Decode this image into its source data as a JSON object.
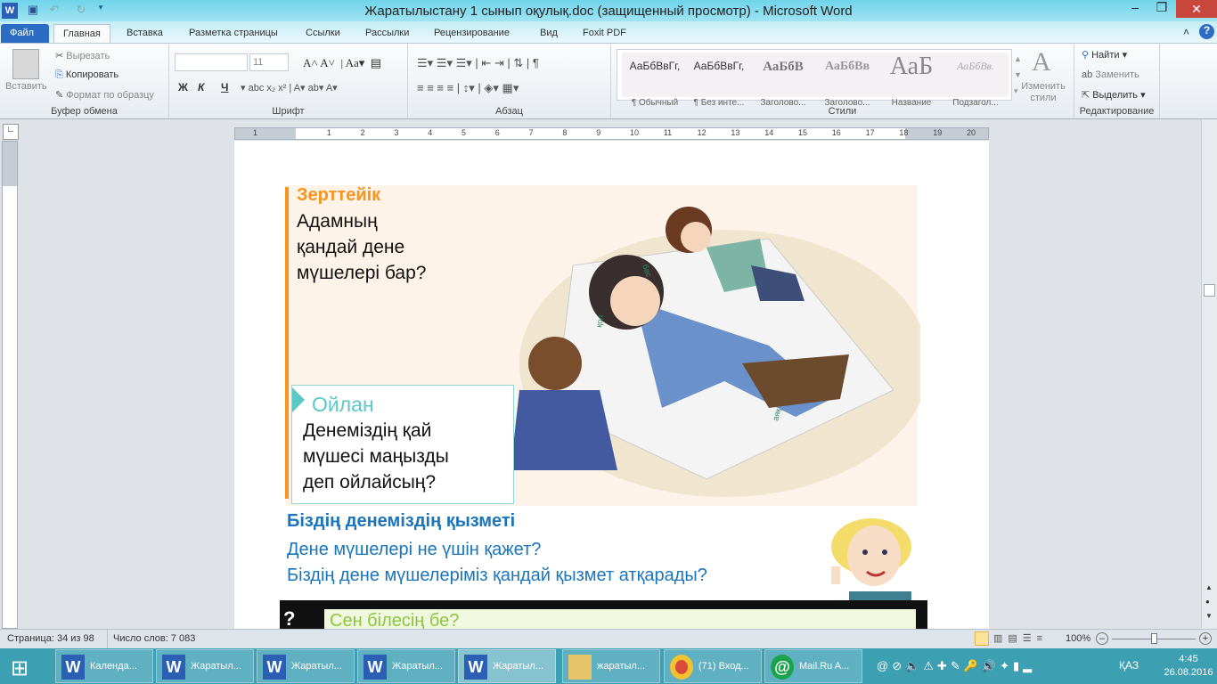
{
  "window": {
    "title": "Жаратылыстану 1 сынып оқулық.doc (защищенный просмотр)  -  Microsoft Word"
  },
  "tabs": [
    "Файл",
    "Главная",
    "Вставка",
    "Разметка страницы",
    "Ссылки",
    "Рассылки",
    "Рецензирование",
    "Вид",
    "Foxit PDF"
  ],
  "clipboard": {
    "paste": "Вставить",
    "cut": "Вырезать",
    "copy": "Копировать",
    "format": "Формат по образцу",
    "label": "Буфер обмена"
  },
  "font": {
    "name": "",
    "size": "11",
    "label": "Шрифт",
    "bold": "Ж",
    "italic": "К",
    "underline": "Ч"
  },
  "paragraph": {
    "label": "Абзац"
  },
  "styles": {
    "label": "Стили",
    "change": "Изменить стили",
    "items": [
      {
        "sample": "АаБбВвГг,",
        "name": "¶ Обычный"
      },
      {
        "sample": "АаБбВвГг,",
        "name": "¶ Без инте..."
      },
      {
        "sample": "АаБбВ",
        "name": "Заголово..."
      },
      {
        "sample": "АаБбВв",
        "name": "Заголово..."
      },
      {
        "sample": "АаБ",
        "name": "Название"
      },
      {
        "sample": "АаБбВв.",
        "name": "Подзагол..."
      }
    ]
  },
  "editing": {
    "find": "Найти",
    "replace": "Заменить",
    "select": "Выделить",
    "label": "Редактирование"
  },
  "ruler": {
    "ticks": [
      "1",
      "1",
      "2",
      "3",
      "4",
      "5",
      "6",
      "7",
      "8",
      "9",
      "10",
      "11",
      "12",
      "13",
      "14",
      "15",
      "16",
      "17",
      "18",
      "19",
      "20"
    ]
  },
  "document": {
    "research_title": "Зерттейік",
    "research_lines": [
      "Адамның",
      "қандай дене",
      "мүшелері бар?"
    ],
    "think_title": "Ойлан",
    "think_lines": [
      "Денеміздің қай",
      "мүшесі маңызды",
      "деп ойлайсың?"
    ],
    "illustration_labels": [
      "бас",
      "қол",
      "аяқ"
    ],
    "section_title": "Біздің денеміздің қызметі",
    "section_lines": [
      "Дене мүшелері не үшін қажет?",
      "Біздің дене мүшелеріміз қандай қызмет атқарады?"
    ],
    "did_you_know": "Сен білесің бе?",
    "colors": {
      "orange": "#f7941d",
      "teal": "#5bc8c8",
      "blue": "#1b75bb",
      "green": "#8cc63f"
    }
  },
  "status": {
    "page": "Страница: 34 из 98",
    "words": "Число слов: 7 083",
    "zoom": "100%",
    "zoom_fraction": 0.5
  },
  "taskbar": {
    "items": [
      "Календа...",
      "Жаратыл...",
      "Жаратыл...",
      "Жаратыл...",
      "Жаратыл...",
      "жаратыл...",
      "(71) Вход...",
      "Mail.Ru A..."
    ],
    "lang": "ҚАЗ",
    "time": "4:45",
    "date": "26.08.2016"
  }
}
